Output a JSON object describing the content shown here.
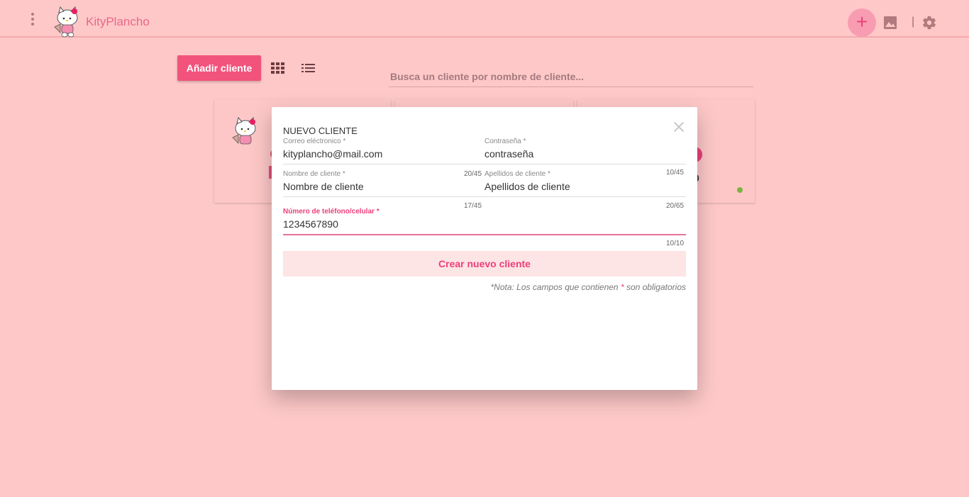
{
  "header": {
    "brand": "KityPlancho",
    "add_icon": "+"
  },
  "toolbar": {
    "add_button": "Añadir cliente",
    "search_placeholder": "Busca un cliente por nombre de cliente..."
  },
  "cards": {
    "partial_text": "0"
  },
  "modal": {
    "title": "NUEVO CLIENTE",
    "email": {
      "label": "Correo eléctronico *",
      "value": "kityplancho@mail.com",
      "counter": "20/45"
    },
    "password": {
      "label": "Contraseña *",
      "value": "contraseña",
      "counter": "10/45"
    },
    "name": {
      "label": "Nombre de cliente *",
      "value": "Nombre de cliente",
      "counter": "17/45"
    },
    "lastname": {
      "label": "Apellidos de cliente *",
      "value": "Apellidos de cliente",
      "counter": "20/65"
    },
    "phone": {
      "label": "Número de teléfono/celular *",
      "value": "1234567890",
      "counter": "10/10"
    },
    "submit": "Crear nuevo cliente",
    "note_prefix": "*Nota: Los campos que contienen ",
    "note_star": "*",
    "note_suffix": " son obligatorios"
  },
  "colors": {
    "background": "#fec8c8",
    "accent": "#ec407a",
    "button": "#f2537c"
  }
}
